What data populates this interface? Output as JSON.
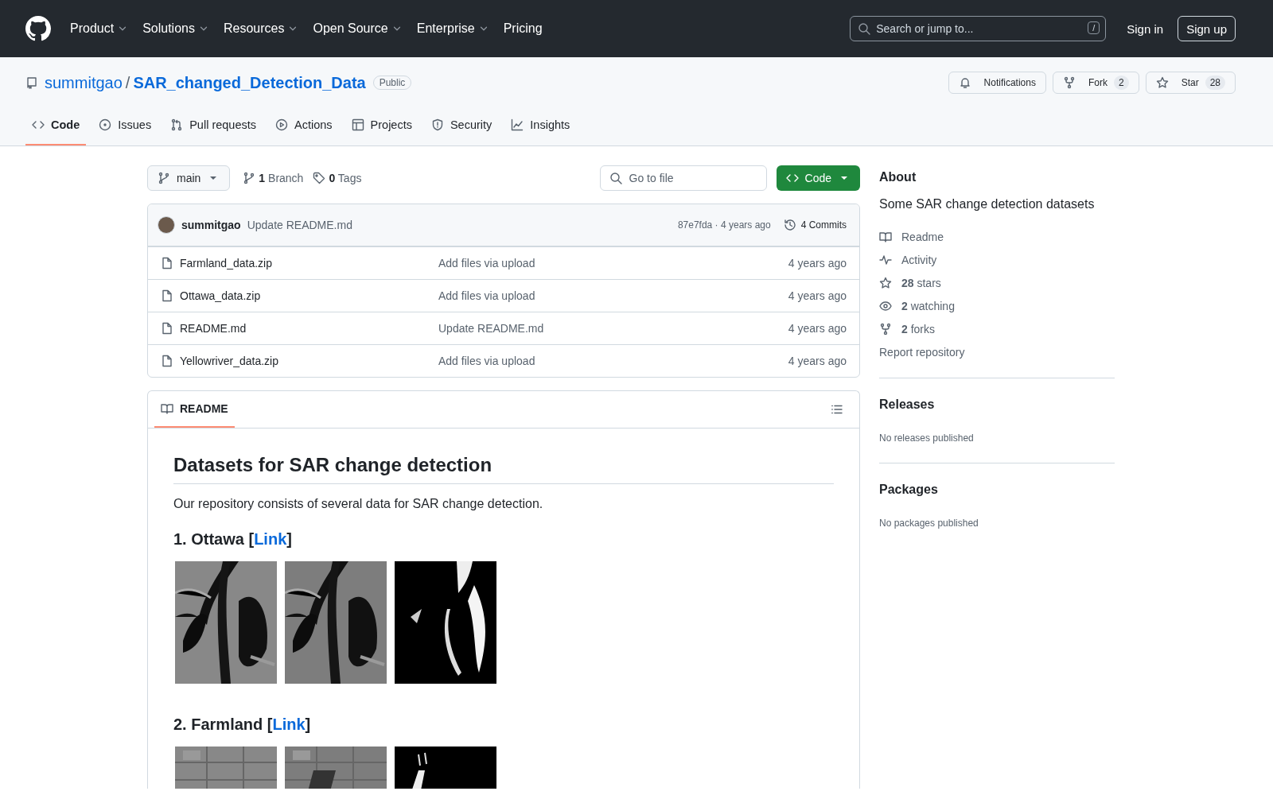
{
  "header": {
    "nav": [
      "Product",
      "Solutions",
      "Resources",
      "Open Source",
      "Enterprise",
      "Pricing"
    ],
    "nav_dropdown": [
      true,
      true,
      true,
      true,
      true,
      false
    ],
    "search": {
      "placeholder": "Search or jump to...",
      "shortcut": "/"
    },
    "sign_in": "Sign in",
    "sign_up": "Sign up"
  },
  "repo": {
    "owner": "summitgao",
    "separator": "/",
    "name": "SAR_changed_Detection_Data",
    "visibility": "Public",
    "actions": [
      {
        "label": "Notifications"
      },
      {
        "label": "Fork",
        "count": "2"
      },
      {
        "label": "Star",
        "count": "28"
      }
    ],
    "tabs": [
      {
        "label": "Code",
        "selected": true
      },
      {
        "label": "Issues",
        "selected": false
      },
      {
        "label": "Pull requests",
        "selected": false
      },
      {
        "label": "Actions",
        "selected": false
      },
      {
        "label": "Projects",
        "selected": false
      },
      {
        "label": "Security",
        "selected": false
      },
      {
        "label": "Insights",
        "selected": false
      }
    ]
  },
  "toolbar": {
    "branch": "main",
    "branches": "**1** Branch",
    "tags": "**0** Tags",
    "go_to_file": {
      "placeholder": "Go to file"
    },
    "code_button": "Code"
  },
  "latest_commit": {
    "author": "summitgao",
    "message": "Update README.md",
    "hash_time": "87e7fda · 4 years ago",
    "commits": "4 Commits"
  },
  "files": [
    {
      "name": "Farmland_data.zip",
      "message": "Add files via upload",
      "time": "4 years ago"
    },
    {
      "name": "Ottawa_data.zip",
      "message": "Add files via upload",
      "time": "4 years ago"
    },
    {
      "name": "README.md",
      "message": "Update README.md",
      "time": "4 years ago"
    },
    {
      "name": "Yellowriver_data.zip",
      "message": "Add files via upload",
      "time": "4 years ago"
    }
  ],
  "readme": {
    "tab": {
      "label": "README",
      "selected": true
    },
    "title": "Datasets for SAR change detection",
    "intro": "Our repository consists of several data for SAR change detection.",
    "sections": [
      {
        "before": "1. Ottawa [",
        "link": "Link",
        "after": "]"
      },
      {
        "before": "2. Farmland [",
        "link": "Link",
        "after": "]"
      }
    ]
  },
  "about": {
    "title": "About",
    "description": "Some SAR change detection datasets",
    "links": [
      {
        "text": "Readme"
      },
      {
        "text": "Activity"
      },
      {
        "text": "**28** stars"
      },
      {
        "text": "**2** watching"
      },
      {
        "text": "**2** forks"
      }
    ],
    "report": "Report repository"
  },
  "releases": {
    "title": "Releases",
    "note": "No releases published"
  },
  "packages": {
    "title": "Packages",
    "note": "No packages published"
  }
}
